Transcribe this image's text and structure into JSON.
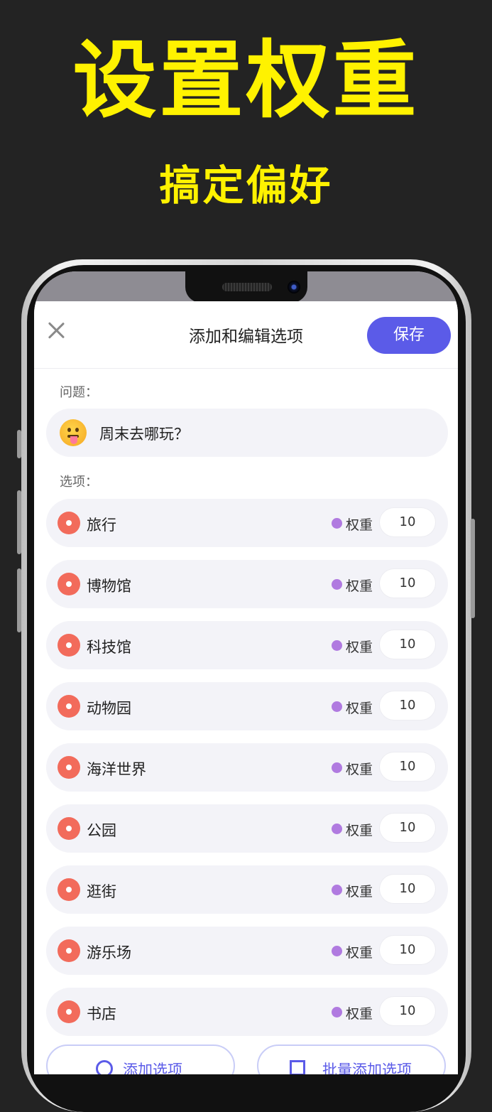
{
  "promo": {
    "headline": "设置权重",
    "subheadline": "搞定偏好"
  },
  "header": {
    "title": "添加和编辑选项",
    "save_label": "保存"
  },
  "question": {
    "label": "问题：",
    "emoji_icon": "tongue-emoji",
    "text": "周末去哪玩？"
  },
  "options_section": {
    "label": "选项：",
    "weight_label": "权重",
    "items": [
      {
        "label": "旅行",
        "weight": "10"
      },
      {
        "label": "博物馆",
        "weight": "10"
      },
      {
        "label": "科技馆",
        "weight": "10"
      },
      {
        "label": "动物园",
        "weight": "10"
      },
      {
        "label": "海洋世界",
        "weight": "10"
      },
      {
        "label": "公园",
        "weight": "10"
      },
      {
        "label": "逛街",
        "weight": "10"
      },
      {
        "label": "游乐场",
        "weight": "10"
      },
      {
        "label": "书店",
        "weight": "10"
      }
    ]
  },
  "footer": {
    "add_option_label": "添加选项",
    "bulk_add_label": "批量添加选项"
  },
  "colors": {
    "accent": "#5b5be8",
    "option_icon": "#f26b5b",
    "weight_dot": "#b07ae0",
    "promo_text": "#fff200",
    "background": "#232323"
  }
}
